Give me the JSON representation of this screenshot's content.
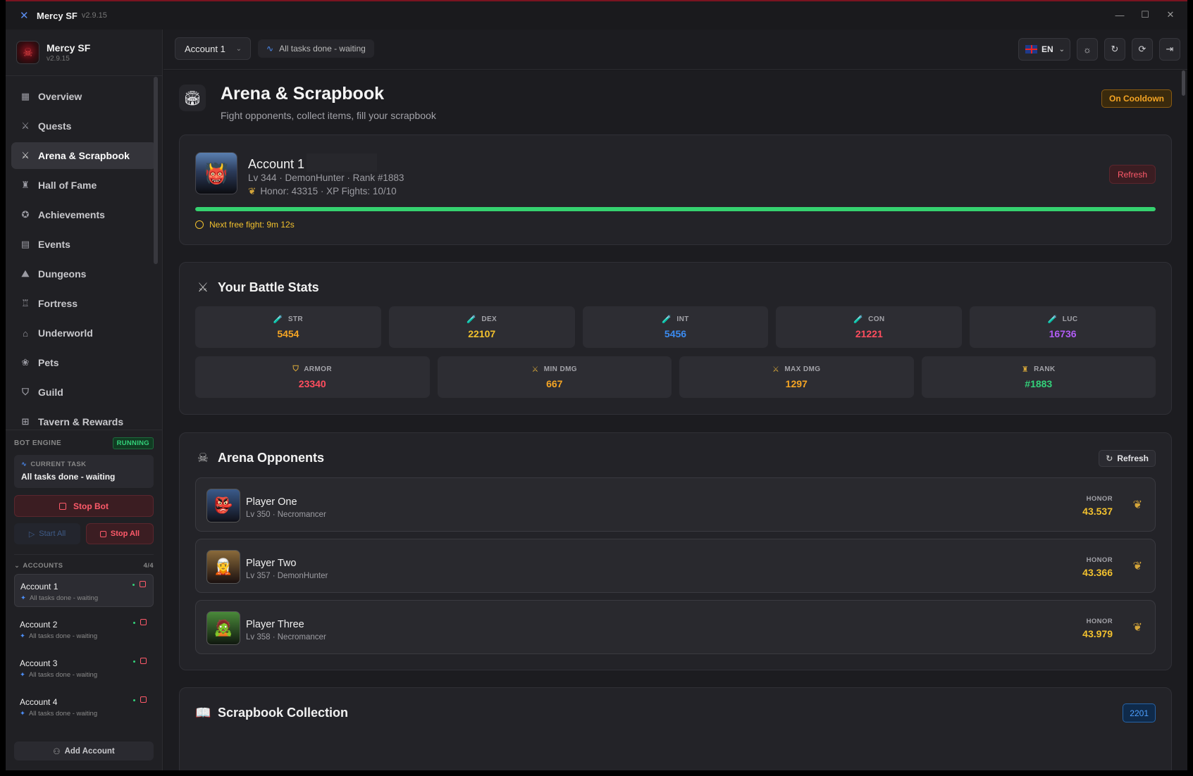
{
  "app": {
    "name": "Mercy SF",
    "version": "v2.9.15"
  },
  "window_controls": {
    "minimize": "—",
    "maximize": "☐",
    "close": "✕"
  },
  "sidebar": {
    "brand_name": "Mercy SF",
    "brand_version": "v2.9.15",
    "nav": [
      {
        "label": "Overview",
        "icon": "grid-icon",
        "glyph": "▦"
      },
      {
        "label": "Quests",
        "icon": "swords-icon",
        "glyph": "⚔"
      },
      {
        "label": "Arena & Scrapbook",
        "icon": "swords-icon",
        "glyph": "⚔"
      },
      {
        "label": "Hall of Fame",
        "icon": "trophy-icon",
        "glyph": "♜"
      },
      {
        "label": "Achievements",
        "icon": "medal-icon",
        "glyph": "✪"
      },
      {
        "label": "Events",
        "icon": "calendar-icon",
        "glyph": "▤"
      },
      {
        "label": "Dungeons",
        "icon": "mountain-icon",
        "glyph": "⛰"
      },
      {
        "label": "Fortress",
        "icon": "castle-icon",
        "glyph": "♖"
      },
      {
        "label": "Underworld",
        "icon": "home-icon",
        "glyph": "⌂"
      },
      {
        "label": "Pets",
        "icon": "paw-icon",
        "glyph": "❀"
      },
      {
        "label": "Guild",
        "icon": "shield-icon",
        "glyph": "⛉"
      },
      {
        "label": "Tavern & Rewards",
        "icon": "gift-icon",
        "glyph": "⊞"
      }
    ],
    "engine": {
      "title": "BOT ENGINE",
      "status": "RUNNING",
      "current_task_label": "CURRENT TASK",
      "current_task": "All tasks done - waiting",
      "stop_bot": "Stop Bot",
      "start_all": "Start All",
      "stop_all": "Stop All"
    },
    "accounts_header": "ACCOUNTS",
    "accounts_count": "4/4",
    "accounts": [
      {
        "name": "Account 1",
        "status": "All tasks done - waiting"
      },
      {
        "name": "Account 2",
        "status": "All tasks done - waiting"
      },
      {
        "name": "Account 3",
        "status": "All tasks done - waiting"
      },
      {
        "name": "Account 4",
        "status": "All tasks done - waiting"
      }
    ],
    "add_account": "Add Account"
  },
  "topbar": {
    "account_select": "Account 1",
    "status": "All tasks done - waiting",
    "language": "EN"
  },
  "page": {
    "title": "Arena & Scrapbook",
    "subtitle": "Fight opponents, collect items, fill your scrapbook",
    "status_badge": "On Cooldown"
  },
  "character": {
    "name": "Account 1",
    "meta": "Lv 344 · DemonHunter · Rank #1883",
    "honor": "Honor: 43315 · XP Fights: 10/10",
    "refresh": "Refresh",
    "xp_fights_fraction": 1.0,
    "next_fight": "Next free fight: 9m 12s"
  },
  "battle_stats": {
    "title": "Your Battle Stats",
    "row1": [
      {
        "label": "STR",
        "value": "5454",
        "color": "#f5a524",
        "potion_color": "#4c8df6"
      },
      {
        "label": "DEX",
        "value": "22107",
        "color": "#f2c12e",
        "potion_color": "#f2c12e"
      },
      {
        "label": "INT",
        "value": "5456",
        "color": "#3b8bf0",
        "potion_color": "#33d17a"
      },
      {
        "label": "CON",
        "value": "21221",
        "color": "#ff4d5e",
        "potion_color": "#d04bd8"
      },
      {
        "label": "LUC",
        "value": "16736",
        "color": "#b15cf5",
        "potion_color": "#ff4d5e"
      }
    ],
    "row2": [
      {
        "label": "ARMOR",
        "value": "23340",
        "color": "#ff4d5e",
        "icon": "shield-icon",
        "glyph": "⛉"
      },
      {
        "label": "MIN DMG",
        "value": "667",
        "color": "#f5a524",
        "icon": "crossed-swords-icon",
        "glyph": "⚔"
      },
      {
        "label": "MAX DMG",
        "value": "1297",
        "color": "#f5a524",
        "icon": "crossed-swords-icon",
        "glyph": "⚔"
      },
      {
        "label": "RANK",
        "value": "#1883",
        "color": "#33d17a",
        "icon": "trophy-icon",
        "glyph": "♜"
      }
    ]
  },
  "opponents": {
    "title": "Arena Opponents",
    "refresh": "Refresh",
    "honor_label": "HONOR",
    "list": [
      {
        "name": "Player One",
        "meta": "Lv 350 · Necromancer",
        "honor": "43.537"
      },
      {
        "name": "Player Two",
        "meta": "Lv 357 · DemonHunter",
        "honor": "43.366"
      },
      {
        "name": "Player Three",
        "meta": "Lv 358 · Necromancer",
        "honor": "43.979"
      }
    ]
  },
  "scrapbook": {
    "title": "Scrapbook Collection",
    "count": "2201"
  }
}
